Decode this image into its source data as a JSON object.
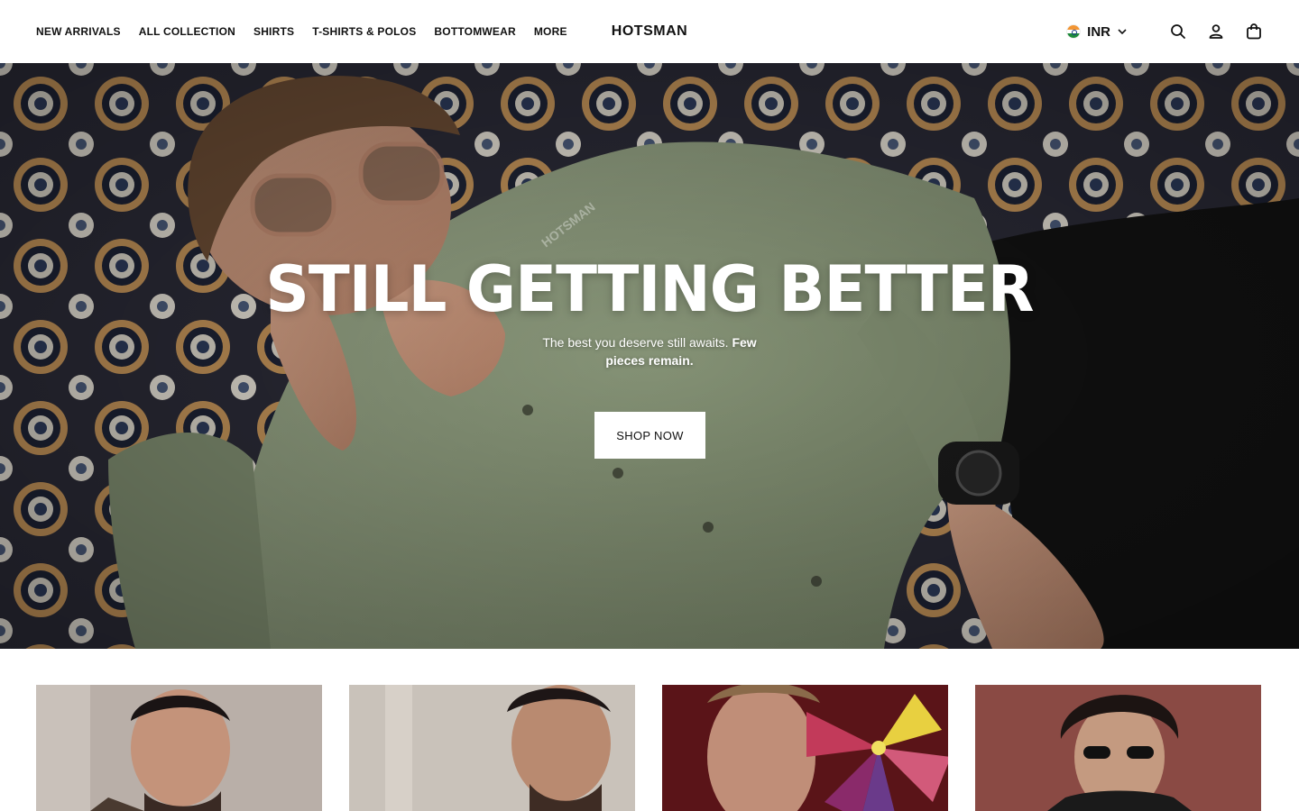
{
  "header": {
    "nav": [
      {
        "label": "NEW ARRIVALS"
      },
      {
        "label": "ALL COLLECTION"
      },
      {
        "label": "SHIRTS"
      },
      {
        "label": "T-SHIRTS & POLOS"
      },
      {
        "label": "BOTTOMWEAR"
      },
      {
        "label": "MORE"
      }
    ],
    "logo": "HOTSMAN",
    "currency": {
      "code": "INR",
      "flag": "india-flag-icon"
    },
    "icons": [
      "search-icon",
      "account-icon",
      "bag-icon"
    ]
  },
  "hero": {
    "watermark": "HOTSMAN",
    "title": "STILL GETTING BETTER",
    "subtitle_plain": "The best you deserve still awaits.",
    "subtitle_bold": "Few pieces remain.",
    "cta": "SHOP NOW"
  },
  "colors": {
    "shirt": "#8e9c7e",
    "rug_dark": "#1c2233",
    "rug_tan": "#b98a4e",
    "button_bg": "#ffffff",
    "header_bg": "#ffffff"
  }
}
